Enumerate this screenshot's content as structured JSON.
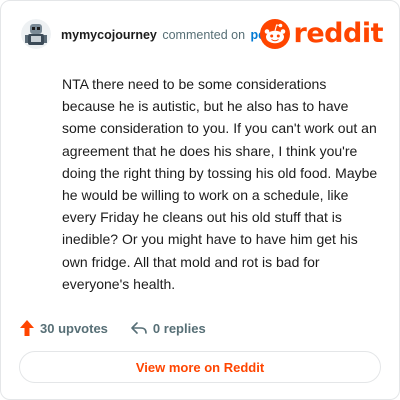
{
  "comment": {
    "author": "mymycojourney",
    "action": "commented on",
    "target_link": "post",
    "body": "NTA there need to be some considerations because he is autistic, but he also has to have some consideration to you. If you can't work out an agreement that he does his share, I think you're doing the right thing by tossing his old food. Maybe he would be willing to work on a schedule, like every Friday he cleans out his old stuff that is inedible? Or you might have to have him get his own fridge. All that mold and rot is bad for everyone's health."
  },
  "brand": {
    "wordmark": "reddit",
    "color": "#ff4500",
    "icon": "reddit-snoo-icon"
  },
  "stats": {
    "upvotes": "30 upvotes",
    "upvote_icon": "upvote-arrow-icon",
    "upvote_color": "#ff4500",
    "replies": "0 replies",
    "reply_icon": "reply-arrow-icon"
  },
  "footer": {
    "view_more_label": "View more on Reddit"
  },
  "colors": {
    "link": "#0079d3",
    "meta_text": "#576f76",
    "body_text": "#1c1c1c"
  }
}
